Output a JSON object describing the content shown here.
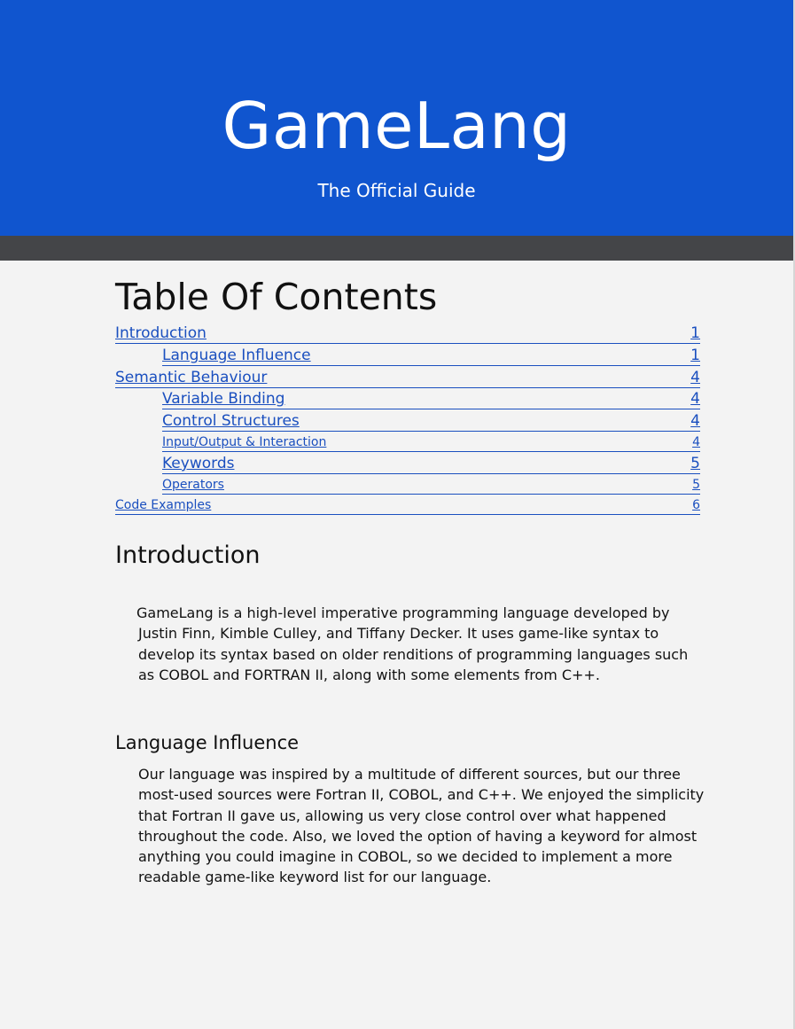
{
  "header": {
    "title": "GameLang",
    "subtitle": "The Official Guide"
  },
  "toc": {
    "title": "Table Of Contents",
    "entries": [
      {
        "label": "Introduction",
        "page": "1"
      },
      {
        "label": "Language Influence",
        "page": "1"
      },
      {
        "label": "Semantic Behaviour",
        "page": "4"
      },
      {
        "label": "Variable Binding",
        "page": "4"
      },
      {
        "label": "Control Structures",
        "page": "4"
      },
      {
        "label": "Input/Output & Interaction",
        "page": "4"
      },
      {
        "label": "Keywords",
        "page": "5"
      },
      {
        "label": "Operators",
        "page": "5"
      },
      {
        "label": "Code Examples",
        "page": "6"
      }
    ]
  },
  "sections": {
    "introduction": {
      "heading": "Introduction",
      "body": "GameLang is a high-level imperative programming language developed by Justin Finn, Kimble Culley, and Tiffany Decker. It uses game-like syntax to develop its syntax based on older renditions of programming languages such as COBOL and FORTRAN II, along with some elements from C++."
    },
    "language_influence": {
      "heading": "Language Influence",
      "body": "Our language was inspired by a multitude of different sources, but our three most-used sources were Fortran II, COBOL, and C++. We enjoyed the simplicity that Fortran II gave us, allowing us very close control over what happened throughout the code. Also, we loved the option of having a keyword for almost anything you could imagine in COBOL, so we decided to implement a more readable game-like keyword list for our language."
    }
  },
  "colors": {
    "header_background": "#1055cf",
    "divider_bar": "#444548",
    "page_background": "#f3f3f3",
    "link": "#1a4fbf"
  }
}
